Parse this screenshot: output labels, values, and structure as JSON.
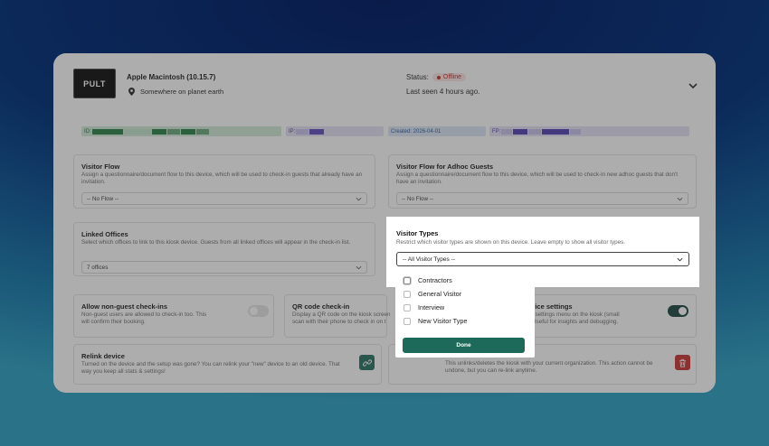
{
  "device": {
    "logo_text": "PULT",
    "name": "Apple Macintosh (10.15.7)",
    "location": "Somewhere on planet earth",
    "status_label": "Status:",
    "status_value": "Offline",
    "last_seen": "Last seen 4 hours ago."
  },
  "info": {
    "id_label": "ID:",
    "ip_label": "IP:",
    "created": "Created: 2026-04-01",
    "fp_label": "FP:"
  },
  "visitor_flow": {
    "title": "Visitor Flow",
    "description": "Assign a questionnaire/document flow to this device, which will be used to check-in guests that already have an invitation.",
    "value": "-- No Flow --"
  },
  "adhoc_flow": {
    "title": "Visitor Flow for Adhoc Guests",
    "description": "Assign a questionnaire/document flow to this device, which will be used to check-in new adhoc guests that don't have an invitation.",
    "value": "-- No Flow --"
  },
  "linked_offices": {
    "title": "Linked Offices",
    "description": "Select which offices to link to this kiosk device. Guests from all linked offices will appear in the check-in list.",
    "value": "7 offices"
  },
  "visitor_types": {
    "title": "Visitor Types",
    "description": "Restrict which visitor types are shown on this device. Leave empty to show all visitor types.",
    "value": "-- All Visitor Types --",
    "options": [
      "Contractors",
      "General Visitor",
      "Interview",
      "New Visitor Type"
    ],
    "done_label": "Done"
  },
  "non_guest": {
    "title": "Allow non-guest check-ins",
    "description": "Non-guest users are allowed to check-in too. This will confirm their booking."
  },
  "qr": {
    "title": "QR code check-in",
    "description_1": "Display a QR code on the kiosk screen",
    "description_2": "scan with their phone to check in on t"
  },
  "device_settings": {
    "title": "evice settings",
    "description_1": "t settings menu on the kiosk (small",
    "description_2": "Useful for insights and debugging."
  },
  "relink": {
    "title": "Relink device",
    "description": "Turned on the device and the setup was gone? You can relink your \"new\" device to an old device. That way you keep all stats & settings!"
  },
  "unlink": {
    "description": "This unlinks/deletes the kiosk with your current organization. This action cannot be undone, but you can re-link anytime."
  },
  "colors": {
    "primary": "#1d6a5b",
    "danger": "#c62828",
    "offline": "#c02424"
  }
}
